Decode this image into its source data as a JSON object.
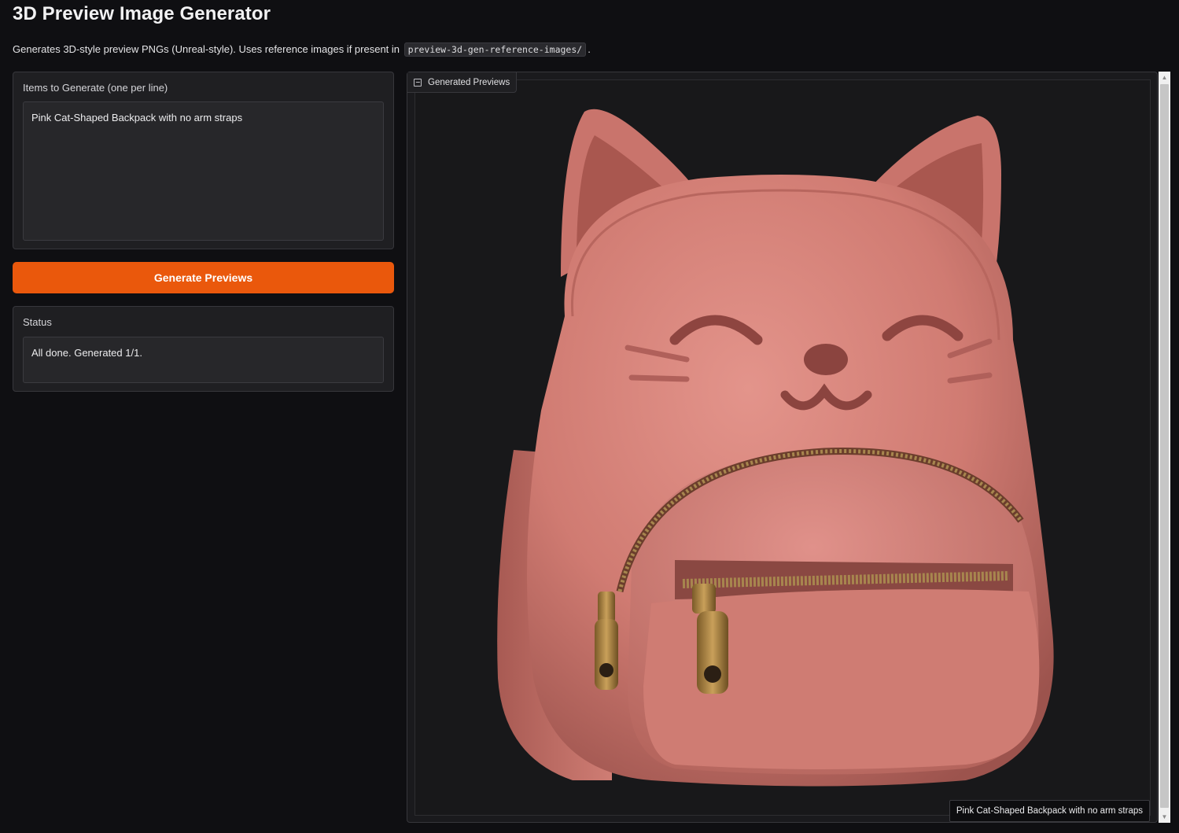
{
  "header": {
    "title": "3D Preview Image Generator",
    "subtitle_prefix": "Generates 3D-style preview PNGs (Unreal-style). Uses reference images if present in",
    "subtitle_code": "preview-3d-gen-reference-images/",
    "subtitle_suffix": "."
  },
  "items_panel": {
    "label": "Items to Generate (one per line)",
    "value": "Pink Cat-Shaped Backpack with no arm straps"
  },
  "generate_button": {
    "label": "Generate Previews"
  },
  "status_panel": {
    "label": "Status",
    "value": "All done. Generated 1/1."
  },
  "gallery": {
    "tab_label": "Generated Previews",
    "tab_icon": "image-icon",
    "caption": "Pink Cat-Shaped Backpack with no arm straps"
  },
  "colors": {
    "accent": "#ea580c",
    "background": "#0f0f12",
    "panel": "#1f1f22",
    "backpack_pink": "#d27c74"
  }
}
